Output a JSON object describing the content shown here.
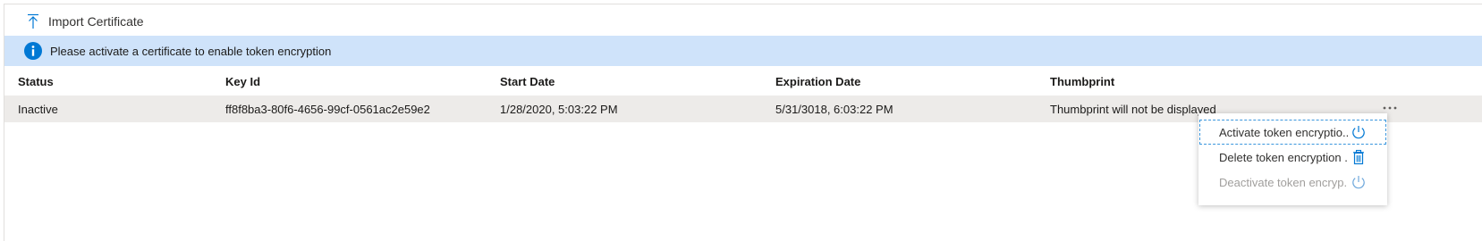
{
  "toolbar": {
    "import_label": "Import Certificate",
    "import_icon": "upload-arrow-icon"
  },
  "info_bar": {
    "icon": "info-icon",
    "message": "Please activate a certificate to enable token encryption",
    "background": "#cfe3fa",
    "icon_color": "#0078d4"
  },
  "table": {
    "columns": [
      "Status",
      "Key Id",
      "Start Date",
      "Expiration Date",
      "Thumbprint"
    ],
    "rows": [
      {
        "status": "Inactive",
        "key_id": "ff8f8ba3-80f6-4656-99cf-0561ac2e59e2",
        "start_date": "1/28/2020, 5:03:22 PM",
        "expiration_date": "5/31/3018, 6:03:22 PM",
        "thumbprint": "Thumbprint will not be displayed"
      }
    ]
  },
  "context_menu": {
    "more_icon": "more-ellipsis-icon",
    "items": [
      {
        "label": "Activate token encryptio...",
        "icon": "power-icon",
        "state": "focused"
      },
      {
        "label": "Delete token encryption ...",
        "icon": "trash-icon",
        "state": "enabled"
      },
      {
        "label": "Deactivate token encryp...",
        "icon": "power-icon",
        "state": "disabled"
      }
    ]
  },
  "colors": {
    "accent": "#0078d4",
    "row_selected": "#edebe9",
    "disabled_text": "#a19f9d"
  }
}
